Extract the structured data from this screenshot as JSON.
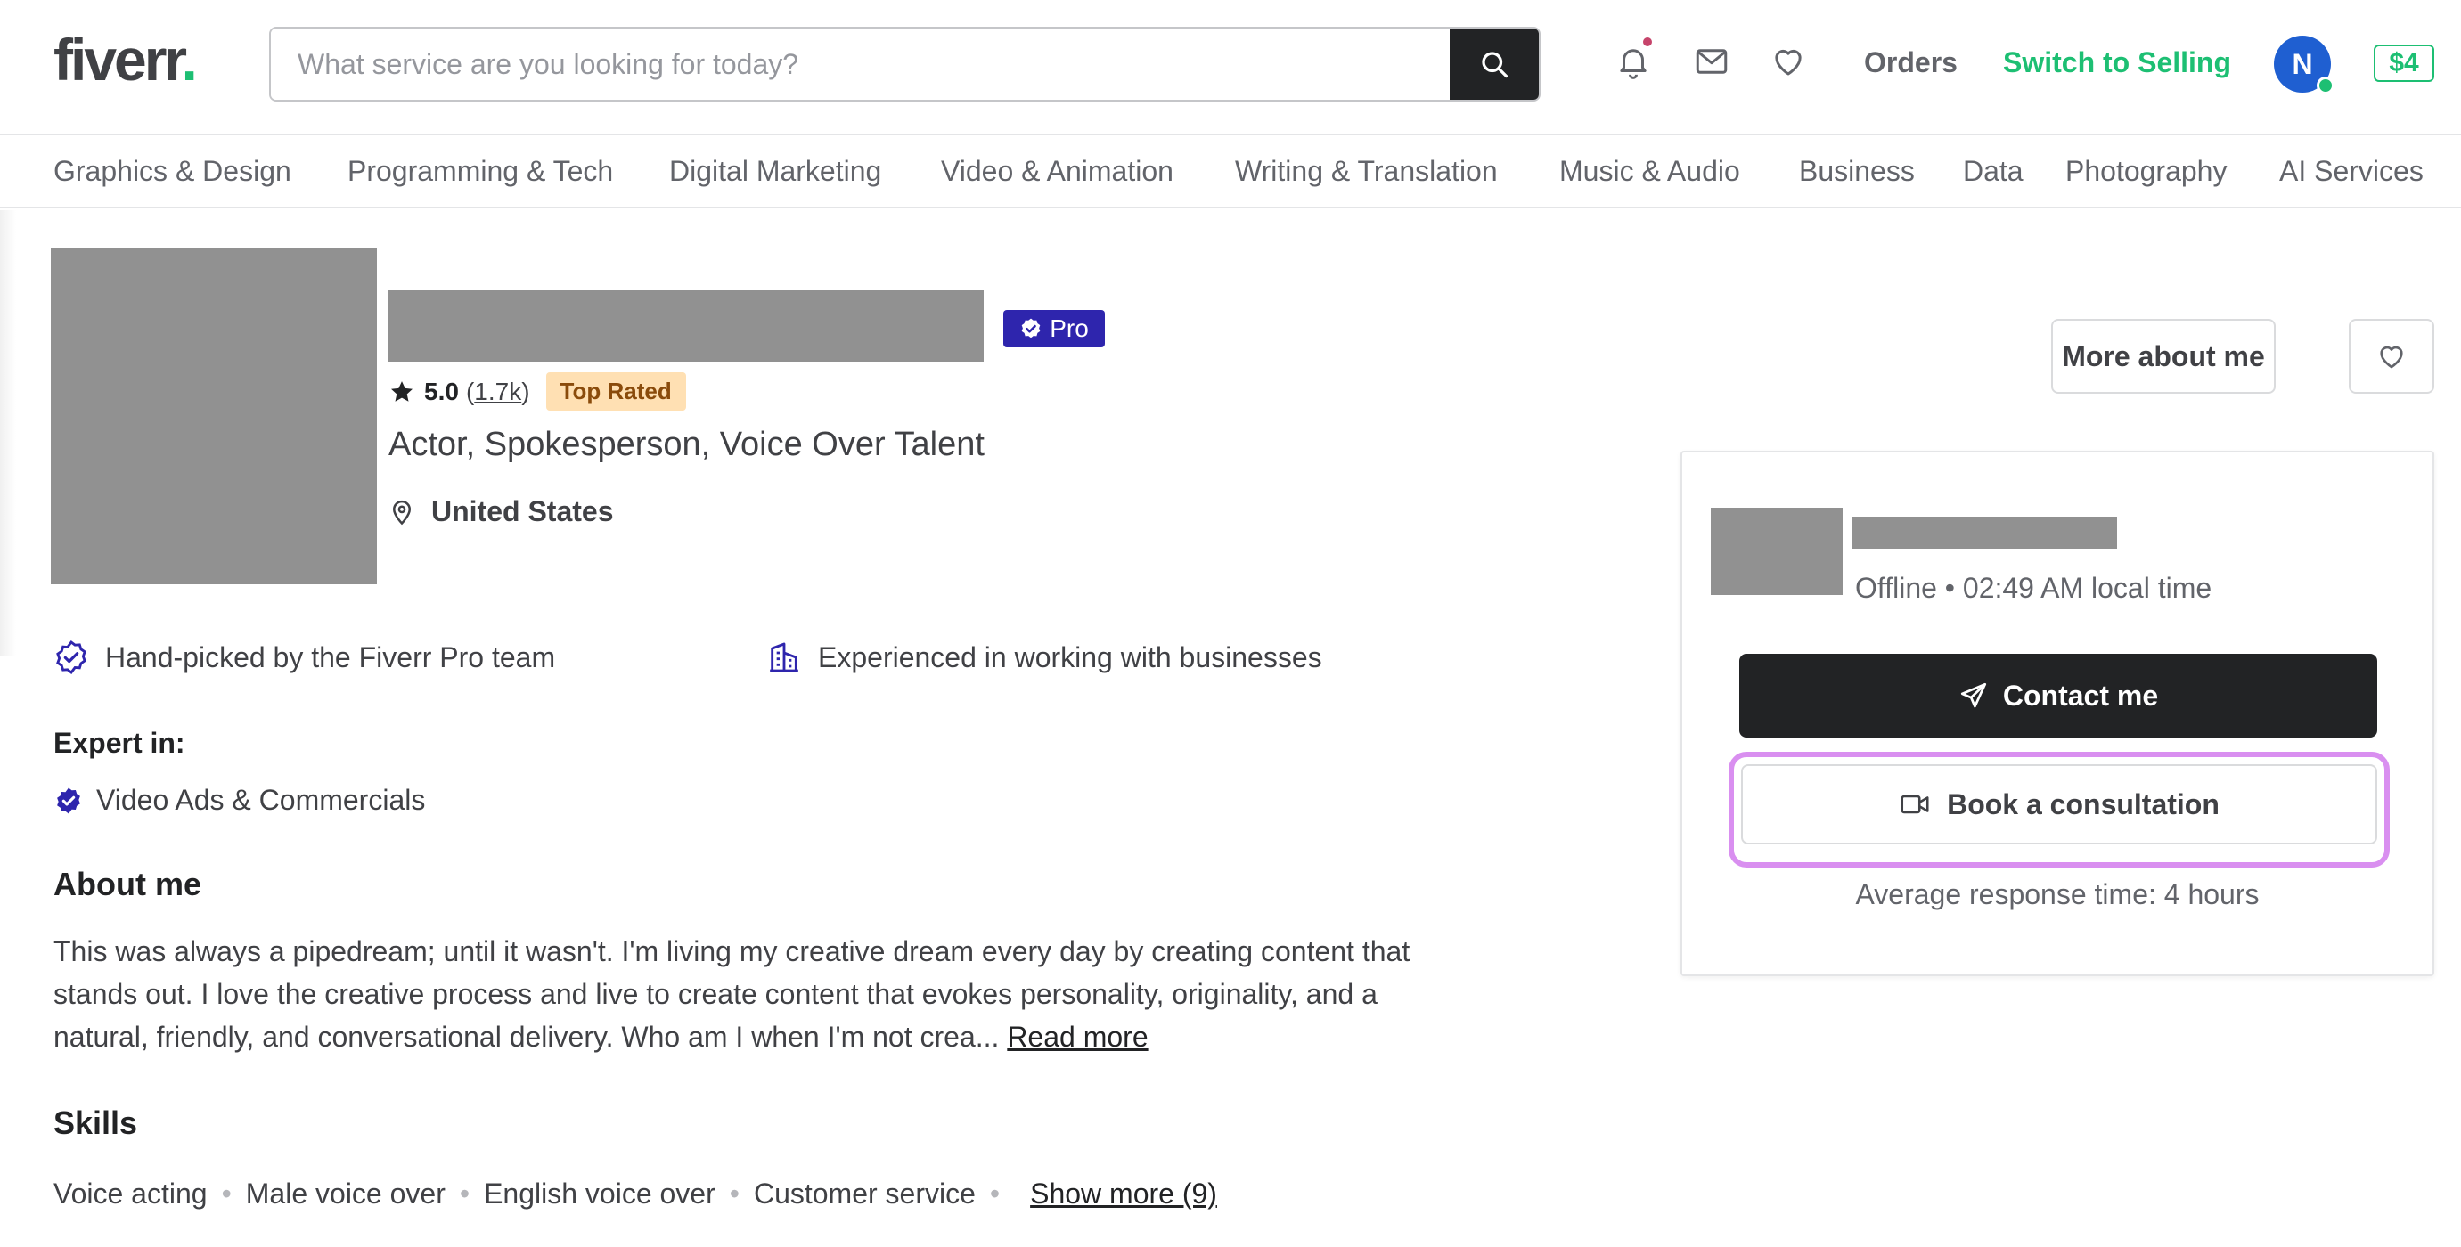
{
  "header": {
    "logo": "fiverr",
    "logo_dot": ".",
    "search_placeholder": "What service are you looking for today?",
    "orders": "Orders",
    "switch_selling": "Switch to Selling",
    "avatar_initial": "N",
    "balance": "$4"
  },
  "categories": [
    "Graphics & Design",
    "Programming & Tech",
    "Digital Marketing",
    "Video & Animation",
    "Writing & Translation",
    "Music & Audio",
    "Business",
    "Data",
    "Photography",
    "AI Services"
  ],
  "profile": {
    "pro_label": "Pro",
    "rating": "5.0",
    "reviews_open": "(",
    "reviews_count": "1.7k",
    "reviews_close": ")",
    "top_rated": "Top Rated",
    "tagline": "Actor, Spokesperson, Voice Over Talent",
    "location": "United States",
    "feature_pro": "Hand-picked by the Fiverr Pro team",
    "feature_business": "Experienced in working with businesses",
    "expert_title": "Expert in:",
    "expert_item": "Video Ads & Commercials",
    "about_title": "About me",
    "about_text": "This was always a pipedream; until it wasn't. I'm living my creative dream every day by creating content that stands out. I love the creative process and live to create content that evokes personality, originality, and a natural, friendly, and conversational delivery. Who am I when I'm not crea...",
    "read_more": "Read more",
    "skills_title": "Skills",
    "skills": [
      "Voice acting",
      "Male voice over",
      "English voice over",
      "Customer service"
    ],
    "show_more": "Show more (9)"
  },
  "side": {
    "more_about": "More about me",
    "status": "Offline • 02:49 AM local time",
    "contact": "Contact me",
    "book": "Book a consultation",
    "response_time": "Average response time: 4 hours"
  },
  "colors": {
    "brand_green": "#1dbf73",
    "pro_purple": "#2e25ad",
    "highlight": "#d98ff0",
    "dark": "#222325"
  }
}
